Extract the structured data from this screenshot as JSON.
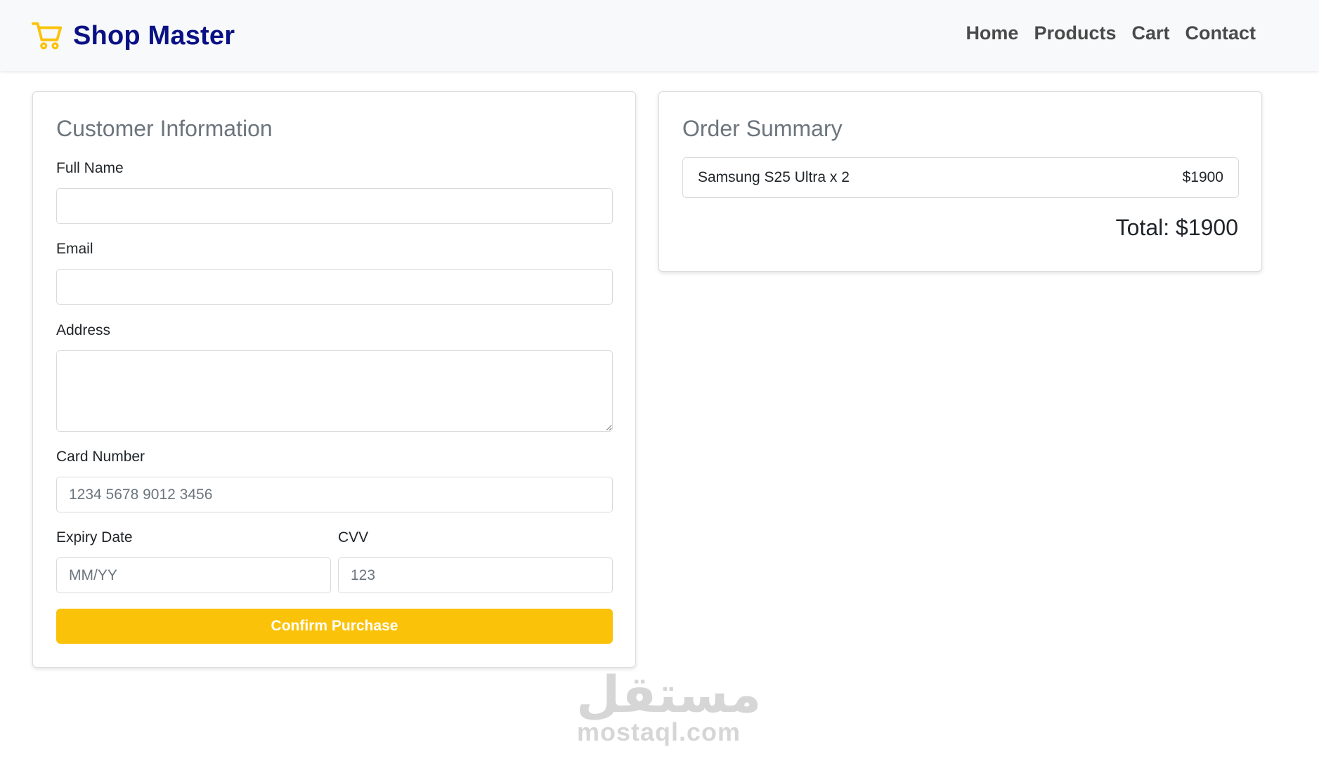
{
  "header": {
    "brand": "Shop Master",
    "brand_icon": "shopping-cart-icon",
    "brand_color": "#0a1185",
    "accent_color": "#fbc20a",
    "nav": [
      {
        "label": "Home"
      },
      {
        "label": "Products"
      },
      {
        "label": "Cart"
      },
      {
        "label": "Contact"
      }
    ]
  },
  "customer": {
    "title": "Customer Information",
    "full_name_label": "Full Name",
    "full_name_value": "",
    "email_label": "Email",
    "email_value": "",
    "address_label": "Address",
    "address_value": "",
    "card_number_label": "Card Number",
    "card_number_placeholder": "1234 5678 9012 3456",
    "expiry_label": "Expiry Date",
    "expiry_placeholder": "MM/YY",
    "cvv_label": "CVV",
    "cvv_placeholder": "123",
    "confirm_label": "Confirm Purchase"
  },
  "summary": {
    "title": "Order Summary",
    "items": [
      {
        "name": "Samsung S25 Ultra x 2",
        "price": "$1900"
      }
    ],
    "total": "Total: $1900"
  },
  "watermark": {
    "arabic": "مستقل",
    "latin": "mostaql.com"
  }
}
